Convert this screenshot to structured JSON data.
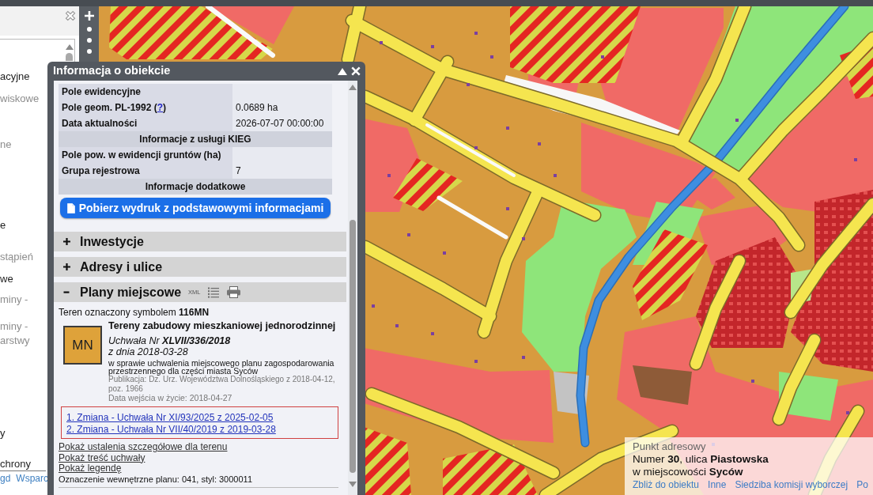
{
  "sidebar": {
    "items": [
      {
        "label": "acyjne",
        "disabled": false
      },
      {
        "label": "wiskowe",
        "disabled": true
      },
      {
        "label": "ne",
        "disabled": true
      },
      {
        "label": "e",
        "disabled": false
      },
      {
        "label": "stąpień",
        "disabled": true
      },
      {
        "label": "we",
        "disabled": false
      },
      {
        "label": "miny -",
        "disabled": true
      },
      {
        "label": "miny -",
        "disabled": true
      },
      {
        "label": "arstwy",
        "disabled": true
      },
      {
        "label": "y",
        "disabled": false
      },
      {
        "label": "chrony",
        "disabled": false
      }
    ],
    "footer_links": [
      "gd",
      "Wsparc"
    ]
  },
  "info_window": {
    "title": "Informacja o obiekcie",
    "attributes": [
      {
        "kind": "field",
        "label": "Pole ewidencyjne"
      },
      {
        "kind": "field",
        "label": "Pole geom. PL-1992 (",
        "link": "?",
        "label_end": ")",
        "value": "0.0689 ha"
      },
      {
        "kind": "field",
        "label": "Data aktualności",
        "value": "2026-07-07 00:00:00"
      },
      {
        "kind": "heading",
        "label": "Informacje z usługi KIEG"
      },
      {
        "kind": "field",
        "label": "Pole pow. w ewidencji gruntów (ha)"
      },
      {
        "kind": "field",
        "label": "Grupa rejestrowa",
        "value": "7"
      },
      {
        "kind": "heading",
        "label": "Informacje dodatkowe"
      }
    ],
    "print_button": "Pobierz wydruk z podstawowymi informacjami",
    "sections": [
      {
        "title": "Inwestycje",
        "expanded": false
      },
      {
        "title": "Adresy i ulice",
        "expanded": false
      },
      {
        "title": "Plany miejscowe",
        "expanded": true,
        "xml_label": "XML",
        "content": {
          "symbol_line": "Teren oznaczony symbolem **116MN**",
          "symbol": "MN",
          "title": "Tereny zabudowy mieszkaniowej jednorodzinnej",
          "resolution": "Uchwała Nr **XLVII/336/2018**",
          "date": "z dnia 2018-03-28",
          "subject": "w sprawie uchwalenia miejscowego planu zagospodarowania przestrzennego dla części miasta Syców",
          "publication": "Publikacja: Dz. Urz. Województwa Dolnośląskiego z 2018-04-12, poz. 1966",
          "effective": "Data wejścia w życie: 2018-04-27",
          "amendments": [
            "1. Zmiana - Uchwała Nr XI/93/2025 z 2025-02-05",
            "2. Zmiana - Uchwała Nr VII/40/2019 z 2019-03-28"
          ],
          "links": [
            "Pokaż ustalenia szczegółowe dla terenu",
            "Pokaż treść uchwały",
            "Pokaż legendę"
          ],
          "internal_code": "Oznaczenie wewnętrzne planu: 041, styl: 3000011"
        }
      }
    ]
  },
  "address_popup": {
    "heading": "Punkt adresowy",
    "line1": "Numer **30**, ulica **Piastowska**",
    "line2": "w miejscowości **Syców**",
    "links": [
      "Zbliż do obiektu",
      "Inne",
      "Siedziba komisji wyborczej",
      "Po"
    ]
  }
}
